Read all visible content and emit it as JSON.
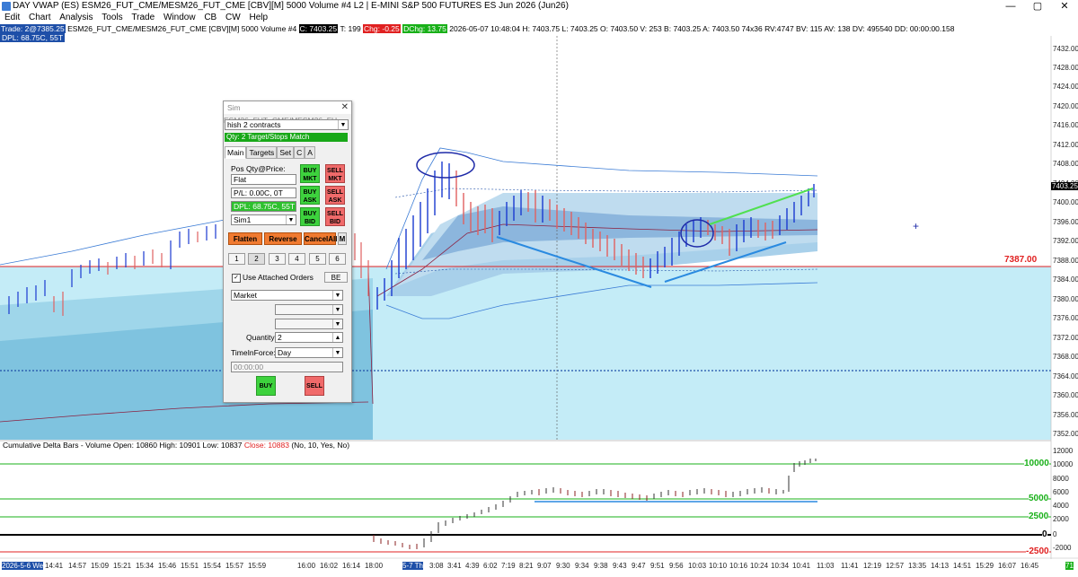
{
  "window": {
    "title": "DAY VWAP (ES) ESM26_FUT_CME/MESM26_FUT_CME [CBV][M]  5000 Volume #4 L2 | E-MINI S&P 500 FUTURES ES Jun 2026 (Jun26)",
    "minimize": "—",
    "restore": "▢",
    "close": "✕"
  },
  "menu": [
    "Edit",
    "Chart",
    "Analysis",
    "Tools",
    "Trade",
    "Window",
    "CB",
    "CW",
    "Help"
  ],
  "info_bar": {
    "trade": "Trade: 2@7385.25",
    "symbol": "ESM26_FUT_CME/MESM26_FUT_CME [CBV][M]  5000 Volume #4",
    "last": "C: 7403.25",
    "trades": "T: 199",
    "chg": "Chg: -0.25",
    "dchg": "DChg: 13.75",
    "details": "2026-05-07  10:48:04 H: 7403.75 L: 7403.25 O: 7403.50 V: 253 B: 7403.25 A: 7403.50 74x36 RV:4747 BV: 115 AV: 138 DV: 495540 DD: 00:00:00.158",
    "dpl": "DPL: 68.75C, 55T"
  },
  "price_axis": [
    "7432.00",
    "7428.00",
    "7424.00",
    "7420.00",
    "7416.00",
    "7412.00",
    "7408.00",
    "7404.00",
    "7400.00",
    "7396.00",
    "7392.00",
    "7388.00",
    "7384.00",
    "7380.00",
    "7376.00",
    "7372.00",
    "7368.00",
    "7364.00",
    "7360.00",
    "7356.00",
    "7352.00"
  ],
  "price_tag": "7387.00",
  "last_tag": "7403.25",
  "cd_title": {
    "text": "Cumulative Delta Bars - Volume  Open: 10860  High: 10901  Low: 10837 ",
    "close": "Close: 10883",
    "params": "  (No, 10, Yes, No)"
  },
  "cd_axis": [
    "12000",
    "10000",
    "8000",
    "6000",
    "4000",
    "2000",
    "0",
    "-2000"
  ],
  "cd_levels": [
    "10000",
    "5000",
    "2500",
    "0",
    "-2500"
  ],
  "time_axis": [
    "2026-5-6 We",
    "14:41",
    "14:57",
    "15:09",
    "15:21",
    "15:34",
    "15:46",
    "15:51",
    "15:54",
    "15:57",
    "15:59",
    "16:00",
    "16:02",
    "16:14",
    "18:00",
    "5-7 Th",
    "3:08",
    "3:41",
    "4:39",
    "6:02",
    "7:19",
    "8:21",
    "9:07",
    "9:30",
    "9:34",
    "9:38",
    "9:43",
    "9:47",
    "9:51",
    "9:56",
    "10:03",
    "10:10",
    "10:16",
    "10:24",
    "10:34",
    "10:41",
    "11:03",
    "11:41",
    "12:19",
    "12:57",
    "13:35",
    "14:13",
    "14:51",
    "15:29",
    "16:07",
    "16:45"
  ],
  "time_corner": "71",
  "order_panel": {
    "title": "Sim ESM26_FUT_CME/MESM26_FU...",
    "close": "✕",
    "account_select": "hish 2 contracts",
    "status_bar": "Qty: 2 Target/Stops Match",
    "tabs": [
      "Main",
      "Targets",
      "Set",
      "C",
      "A"
    ],
    "pos_label": "Pos Qty@Price:",
    "pos_value": "Flat",
    "pl_value": "P/L: 0.00C, 0T",
    "dpl_value": "DPL: 68.75C, 55T",
    "account": "Sim1",
    "buy_mkt": [
      "BUY",
      "MKT"
    ],
    "sell_mkt": [
      "SELL",
      "MKT"
    ],
    "buy_ask": [
      "BUY",
      "ASK"
    ],
    "sell_ask": [
      "SELL",
      "ASK"
    ],
    "buy_bid": [
      "BUY",
      "BID"
    ],
    "sell_bid": [
      "SELL",
      "BID"
    ],
    "flatten": "Flatten",
    "reverse": "Reverse",
    "cancel_all": "CancelAll",
    "m": "M",
    "qty_buttons": [
      "1",
      "2",
      "3",
      "4",
      "5",
      "6"
    ],
    "be": "BE",
    "use_attached": "Use Attached Orders",
    "order_type": "Market",
    "quantity_label": "Quantity:",
    "quantity": "2",
    "tif_label": "TimeInForce:",
    "tif": "Day",
    "time": "00:00:00",
    "buy": "BUY",
    "sell": "SELL"
  },
  "colors": {
    "accent_blue": "#1e4fa8",
    "red": "#e02020",
    "green": "#18b018",
    "band_light": "#b3e6f2"
  }
}
